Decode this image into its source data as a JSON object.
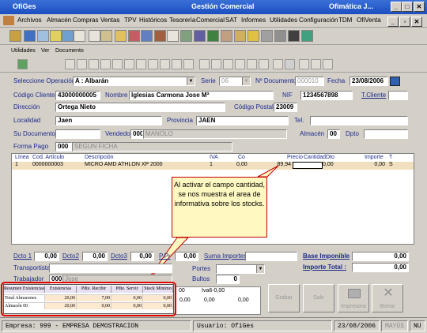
{
  "window": {
    "app": "OfiGes",
    "title": "Gestión Comercial",
    "right_title": "Ofimática J..."
  },
  "menu": [
    "Archivos",
    "Almacén",
    "Compras",
    "Ventas",
    "TPV",
    "Históricos",
    "Tesorería",
    "Comercial",
    "SAT",
    "Informes",
    "Utilidades",
    "Configuración",
    "TDM",
    "OfiVenta"
  ],
  "submenu": [
    "Utilidades",
    "Ver",
    "Documento"
  ],
  "form": {
    "op_label": "Seleccione Operación",
    "op_value": "A : Albarán",
    "serie_label": "Serie",
    "serie_value": "06",
    "ndoc_label": "Nº Documento",
    "ndoc_value": "000010",
    "fecha_label": "Fecha",
    "fecha_value": "23/08/2006",
    "cli_label": "Código Cliente",
    "cli_value": "43000000005",
    "nombre_label": "Nombre",
    "nombre_value": "Iglesias Carmona Jose Mª",
    "nif_label": "NIF",
    "nif_value": "1234567898",
    "tcli_label": "T.Cliente",
    "dir_label": "Dirección",
    "dir_value": "Ortega Nieto",
    "cp_label": "Código Postal",
    "cp_value": "23009",
    "loc_label": "Localidad",
    "loc_value": "Jaen",
    "prov_label": "Provincia",
    "prov_value": "JAEN",
    "tel_label": "Tel.",
    "sudoc_label": "Su Documento",
    "vend_label": "Vendedor",
    "vend_code": "000",
    "vend_name": "MANOLO",
    "alm_label": "Almacén",
    "alm_value": "00",
    "dpto_label": "Dpto",
    "fpago_label": "Forma Pago",
    "fpago_code": "000",
    "fpago_name": "SEGUN FICHA"
  },
  "grid": {
    "headers": [
      "Línea",
      "Cod. Artículo",
      "Descripción",
      "IVA",
      "Co",
      "Precio",
      "Cantidad",
      "Dto",
      "Importe",
      "T"
    ],
    "row": [
      "1",
      "0000000003",
      "MICRO AMD ATHLON XP 2000",
      "1",
      "0,00",
      "89,94",
      "1",
      "0,00",
      "0,00",
      "S"
    ]
  },
  "callout": "Al activar el campo cantidad, se nos muestra el area de informativa sobre los stocks.",
  "totals": {
    "dto1": "Dcto 1",
    "dto1_val": "0,00",
    "dto2": "Dcto2",
    "dto2_val": "0,00",
    "dto3": "Dcto3",
    "dto3_val": "0,00",
    "pp": "P.Pr",
    "pp_val": "0,00",
    "suma": "Suma Importes",
    "base": "Base Imponible",
    "base_val": "0,00",
    "importe": "Importe Total :",
    "importe_val": "0,00",
    "transp": "Transportista",
    "portes": "Portes",
    "trab": "Trabajador",
    "trab_code": "000",
    "trab_name": "Jose",
    "bultos": "Bultos",
    "bultos_val": "0",
    "iva_hdr1": "00",
    "iva_hdr2": "Iva6-0,00",
    "iva_val1": "0,00",
    "iva_val2": "0,00",
    "iva_val3": "0,00"
  },
  "stock": {
    "headers": [
      "Resumen Existencias",
      "Existencias",
      "Pdte. Recibir",
      "Pdte. Servir",
      "Stock Mínimo"
    ],
    "rows": [
      [
        "Total Almacenes",
        "20,00",
        "7,00",
        "0,00",
        "0,00"
      ],
      [
        "Almacén 00",
        "20,00",
        "0,00",
        "0,00",
        "0,00"
      ]
    ]
  },
  "buttons": {
    "grabar": "Grabar",
    "salir": "Salir",
    "impresora": "Impresora",
    "borrar": "Borrar"
  },
  "status": {
    "empresa": "Empresa: 999 - EMPRESA DEMOSTRACION",
    "usuario": "Usuario: OfiGes",
    "fecha": "23/08/2006",
    "mayus": "MAYÚS",
    "nu": "NU"
  }
}
